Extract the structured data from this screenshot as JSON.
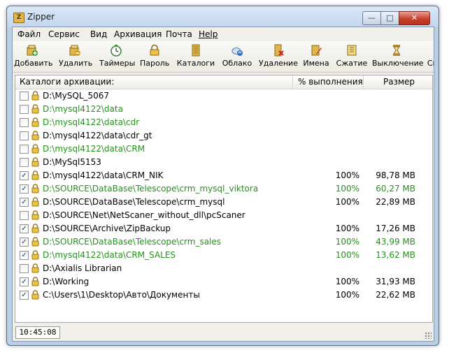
{
  "window": {
    "title": "Zipper"
  },
  "menu": [
    "Файл",
    "Сервис",
    "Вид",
    "Архивация",
    "Почта",
    "Help"
  ],
  "toolbar": [
    {
      "label": "Добавить",
      "icon": "add-archive-icon"
    },
    {
      "label": "Удалить",
      "icon": "delete-archive-icon"
    },
    {
      "label": "Таймеры",
      "icon": "timer-icon"
    },
    {
      "label": "Пароль",
      "icon": "password-lock-icon"
    },
    {
      "label": "Каталоги",
      "icon": "folders-icon"
    },
    {
      "label": "Облако",
      "icon": "cloud-icon"
    },
    {
      "label": "Удаление",
      "icon": "removal-icon"
    },
    {
      "label": "Имена",
      "icon": "names-icon"
    },
    {
      "label": "Сжатие",
      "icon": "compression-icon"
    },
    {
      "label": "Выключение",
      "icon": "shutdown-icon"
    },
    {
      "label": "Ск",
      "icon": "more-icon"
    }
  ],
  "list": {
    "columns": [
      "Каталоги архивации:",
      "% выполнения",
      "Размер"
    ],
    "rows": [
      {
        "path": "D:\\MySQL_5067",
        "checked": false,
        "color": "black",
        "percent": "",
        "size": ""
      },
      {
        "path": "D:\\mysql4122\\data",
        "checked": false,
        "color": "green",
        "percent": "",
        "size": ""
      },
      {
        "path": "D:\\mysql4122\\data\\cdr",
        "checked": false,
        "color": "green",
        "percent": "",
        "size": ""
      },
      {
        "path": "D:\\mysql4122\\data\\cdr_gt",
        "checked": false,
        "color": "black",
        "percent": "",
        "size": ""
      },
      {
        "path": "D:\\mysql4122\\data\\CRM",
        "checked": false,
        "color": "green",
        "percent": "",
        "size": ""
      },
      {
        "path": "D:\\MySql5153",
        "checked": false,
        "color": "black",
        "percent": "",
        "size": ""
      },
      {
        "path": "D:\\mysql4122\\data\\CRM_NIK",
        "checked": true,
        "color": "black",
        "percent": "100%",
        "size": "98,78 MB"
      },
      {
        "path": "D:\\SOURCE\\DataBase\\Telescope\\crm_mysql_viktora",
        "checked": true,
        "color": "green",
        "percent": "100%",
        "size": "60,27 MB"
      },
      {
        "path": "D:\\SOURCE\\DataBase\\Telescope\\crm_mysql",
        "checked": true,
        "color": "black",
        "percent": "100%",
        "size": "22,89 MB"
      },
      {
        "path": "D:\\SOURCE\\Net\\NetScaner_without_dll\\pcScaner",
        "checked": false,
        "color": "black",
        "percent": "",
        "size": ""
      },
      {
        "path": "D:\\SOURCE\\Archive\\ZipBackup",
        "checked": true,
        "color": "black",
        "percent": "100%",
        "size": "17,26 MB"
      },
      {
        "path": "D:\\SOURCE\\DataBase\\Telescope\\crm_sales",
        "checked": true,
        "color": "green",
        "percent": "100%",
        "size": "43,99 MB"
      },
      {
        "path": "D:\\mysql4122\\data\\CRM_SALES",
        "checked": true,
        "color": "green",
        "percent": "100%",
        "size": "13,62 MB"
      },
      {
        "path": "D:\\Axialis Librarian",
        "checked": false,
        "color": "black",
        "percent": "",
        "size": ""
      },
      {
        "path": "D:\\Working",
        "checked": true,
        "color": "black",
        "percent": "100%",
        "size": "31,93 MB"
      },
      {
        "path": "C:\\Users\\1\\Desktop\\Авто\\Документы",
        "checked": true,
        "color": "black",
        "percent": "100%",
        "size": "22,62 MB"
      }
    ]
  },
  "status": {
    "time": "10:45:08"
  }
}
